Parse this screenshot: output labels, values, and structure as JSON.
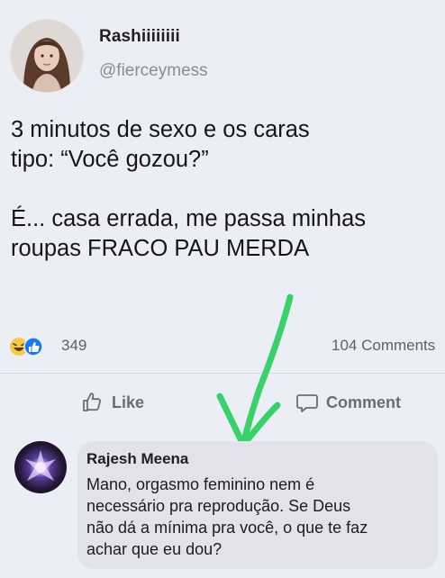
{
  "post": {
    "display_name": "Rashiiiiiiii",
    "handle": "@fierceymess",
    "text_lines": [
      "3 minutos de sexo e os caras",
      "tipo: “Você gozou?”",
      "É... casa errada, me passa minhas",
      "roupas FRACO PAU MERDA"
    ]
  },
  "stats": {
    "reaction_icons": [
      "laugh-emoji-icon",
      "thumbs-up-icon"
    ],
    "reaction_count": "349",
    "comment_count": "104 Comments"
  },
  "actions": {
    "like_label": "Like",
    "comment_label": "Comment"
  },
  "comment": {
    "author": "Rajesh Meena",
    "text_lines": [
      "Mano, orgasmo feminino nem é",
      "necessário pra reprodução. Se Deus",
      "não dá a mínima pra você, o que te faz",
      "achar que eu dou?"
    ]
  },
  "colors": {
    "background": "#eceef6",
    "arrow_green": "#39d26a",
    "like_blue": "#1877f2",
    "laugh_yellow": "#f7c948"
  }
}
